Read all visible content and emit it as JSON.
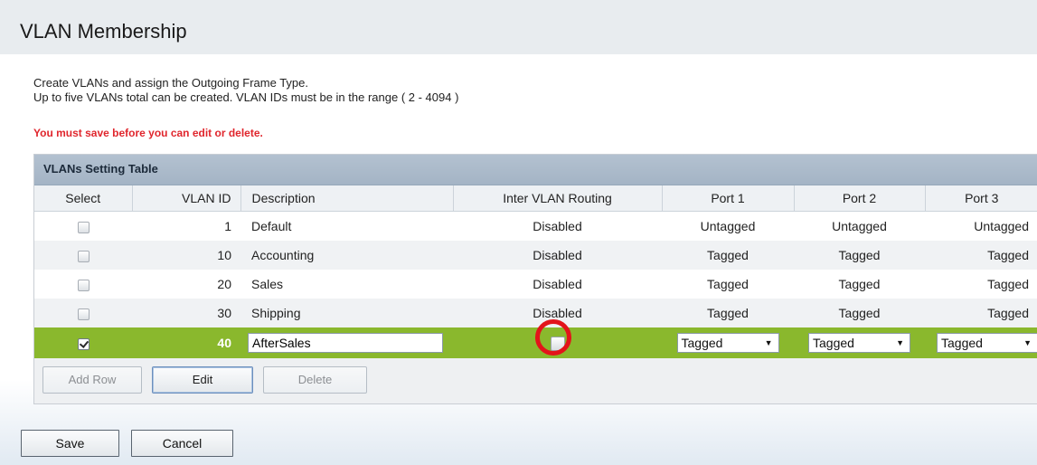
{
  "page": {
    "title": "VLAN Membership"
  },
  "intro": {
    "line1": "Create VLANs and assign the Outgoing Frame Type.",
    "line2": "Up to five VLANs total can be created. VLAN IDs must be in the range ( 2 - 4094 )",
    "warning": "You must save before you can edit or delete."
  },
  "table": {
    "title": "VLANs Setting Table",
    "headers": {
      "select": "Select",
      "vlan_id": "VLAN ID",
      "description": "Description",
      "inter_vlan": "Inter VLAN Routing",
      "port1": "Port 1",
      "port2": "Port 2",
      "port3": "Port 3"
    },
    "rows": [
      {
        "vlan_id": "1",
        "description": "Default",
        "inter_vlan": "Disabled",
        "port1": "Untagged",
        "port2": "Untagged",
        "port3": "Untagged",
        "checked": false
      },
      {
        "vlan_id": "10",
        "description": "Accounting",
        "inter_vlan": "Disabled",
        "port1": "Tagged",
        "port2": "Tagged",
        "port3": "Tagged",
        "checked": false
      },
      {
        "vlan_id": "20",
        "description": "Sales",
        "inter_vlan": "Disabled",
        "port1": "Tagged",
        "port2": "Tagged",
        "port3": "Tagged",
        "checked": false
      },
      {
        "vlan_id": "30",
        "description": "Shipping",
        "inter_vlan": "Disabled",
        "port1": "Tagged",
        "port2": "Tagged",
        "port3": "Tagged",
        "checked": false
      }
    ],
    "edit_row": {
      "vlan_id": "40",
      "description": "AfterSales",
      "checked": true,
      "inter_vlan_checked": false,
      "port1": "Tagged",
      "port2": "Tagged",
      "port3": "Tagged"
    },
    "buttons": {
      "add_row": "Add Row",
      "edit": "Edit",
      "delete": "Delete"
    }
  },
  "footer": {
    "save": "Save",
    "cancel": "Cancel"
  },
  "colors": {
    "selected_row": "#8ab82d",
    "warning": "#e0262d",
    "highlight_ring": "#e3141a"
  }
}
